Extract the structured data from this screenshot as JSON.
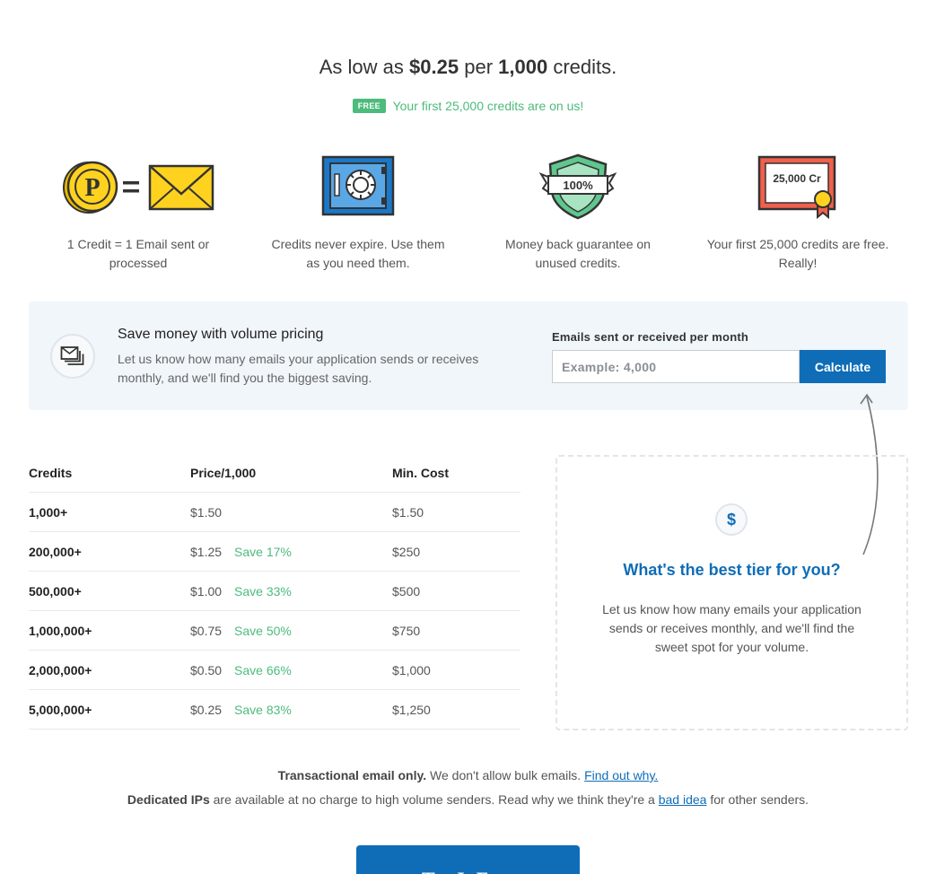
{
  "hero": {
    "prefix": "As low as",
    "price": "$0.25",
    "middle": "per",
    "amount": "1,000",
    "suffix": "credits.",
    "badge": "FREE",
    "free_text": "Your first 25,000 credits are on us!"
  },
  "features": [
    {
      "icon": "coin-equals-envelope-icon",
      "text": "1 Credit = 1 Email sent or processed",
      "coin_letter": "P"
    },
    {
      "icon": "safe-icon",
      "text": "Credits never expire. Use them as you need them."
    },
    {
      "icon": "shield-icon",
      "text": "Money back guarantee on unused credits.",
      "shield_label": "100%"
    },
    {
      "icon": "certificate-icon",
      "text": "Your first 25,000 credits are free. Really!",
      "cert_label": "25,000 Cr"
    }
  ],
  "calculator": {
    "icon": "emails-stack-icon",
    "title": "Save money with volume pricing",
    "description": "Let us know how many emails your application sends or receives monthly, and we'll find you the biggest saving.",
    "input_label": "Emails sent or received per month",
    "input_placeholder": "Example: 4,000",
    "button_label": "Calculate"
  },
  "pricing_table": {
    "headers": [
      "Credits",
      "Price/1,000",
      "Min. Cost"
    ],
    "rows": [
      {
        "credits": "1,000+",
        "price": "$1.50",
        "save": "",
        "min_cost": "$1.50"
      },
      {
        "credits": "200,000+",
        "price": "$1.25",
        "save": "Save 17%",
        "min_cost": "$250"
      },
      {
        "credits": "500,000+",
        "price": "$1.00",
        "save": "Save 33%",
        "min_cost": "$500"
      },
      {
        "credits": "1,000,000+",
        "price": "$0.75",
        "save": "Save 50%",
        "min_cost": "$750"
      },
      {
        "credits": "2,000,000+",
        "price": "$0.50",
        "save": "Save 66%",
        "min_cost": "$1,000"
      },
      {
        "credits": "5,000,000+",
        "price": "$0.25",
        "save": "Save 83%",
        "min_cost": "$1,250"
      }
    ]
  },
  "tier_box": {
    "icon": "dollar-icon",
    "icon_glyph": "$",
    "title": "What's the best tier for you?",
    "description": "Let us know how many emails your application sends or receives monthly, and we'll find the sweet spot for your volume."
  },
  "notes": {
    "line1_bold": "Transactional email only.",
    "line1_text": "We don't allow bulk emails.",
    "line1_link": "Find out why.",
    "line2_bold": "Dedicated IPs",
    "line2_text": "are available at no charge to high volume senders. Read why we think they're a",
    "line2_link": "bad idea",
    "line2_tail": "for other senders."
  },
  "cta": {
    "label": "Try It Free"
  },
  "colors": {
    "accent": "#0f6db7",
    "green": "#4cbb7b",
    "panel_bg": "#f1f6fb"
  }
}
